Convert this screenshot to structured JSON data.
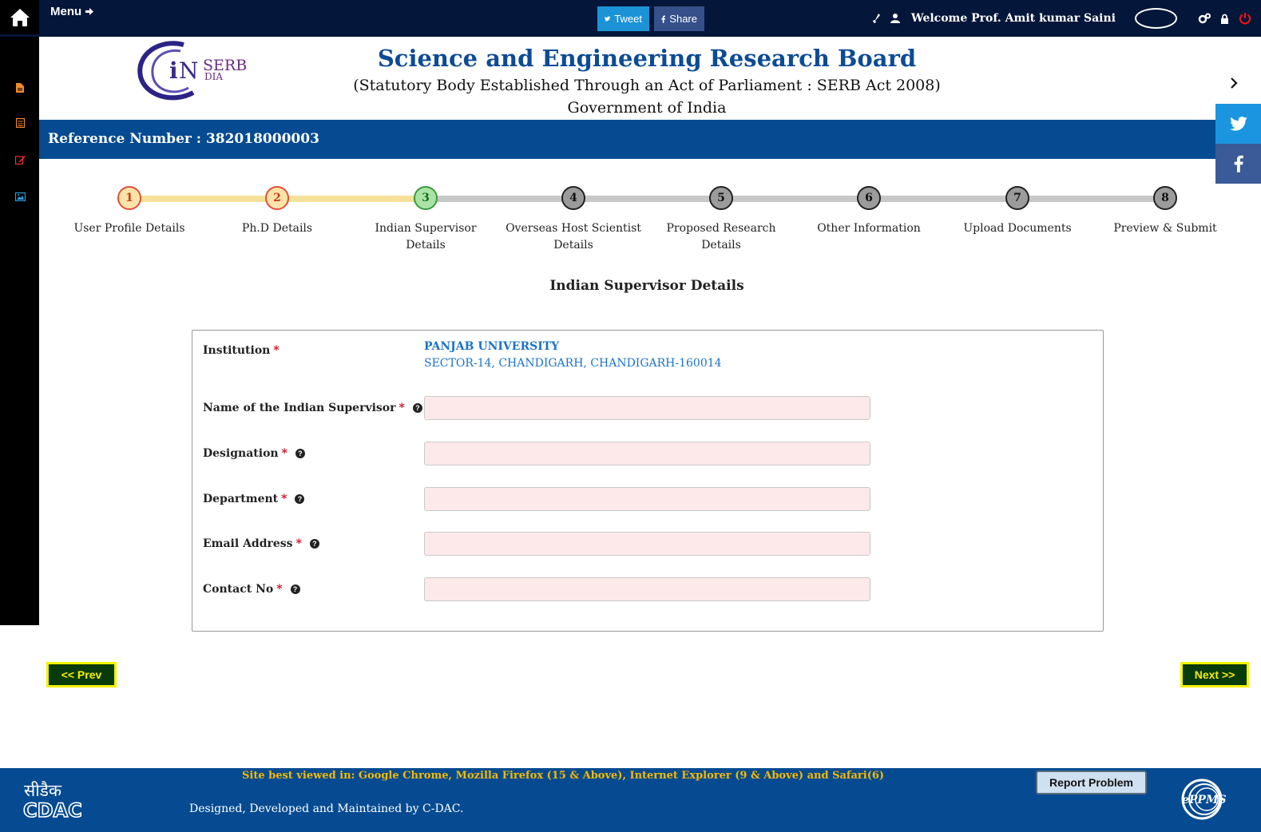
{
  "topbar": {
    "menu_label": "Menu",
    "tweet_label": "Tweet",
    "share_label": "Share",
    "welcome_text": "Welcome Prof. Amit kumar Saini"
  },
  "header": {
    "org_title": "Science and Engineering Research Board",
    "org_subtitle": "(Statutory Body Established Through an Act of Parliament : SERB Act 2008)",
    "org_gov": "Government of India",
    "logo_text_1": "SERB",
    "logo_text_2": "DIA"
  },
  "reference": {
    "text": "Reference Number : 382018000003"
  },
  "stepper": {
    "steps": [
      {
        "num": "1",
        "label": "User Profile Details",
        "state": "completed"
      },
      {
        "num": "2",
        "label": "Ph.D Details",
        "state": "completed"
      },
      {
        "num": "3",
        "label": "Indian Supervisor Details",
        "state": "current"
      },
      {
        "num": "4",
        "label": "Overseas Host Scientist Details",
        "state": "pending"
      },
      {
        "num": "5",
        "label": "Proposed Research Details",
        "state": "pending"
      },
      {
        "num": "6",
        "label": "Other Information",
        "state": "pending"
      },
      {
        "num": "7",
        "label": "Upload Documents",
        "state": "pending"
      },
      {
        "num": "8",
        "label": "Preview & Submit",
        "state": "pending"
      }
    ]
  },
  "form": {
    "section_title": "Indian Supervisor Details",
    "institution_label": "Institution",
    "institution_name": "PANJAB UNIVERSITY",
    "institution_address": "SECTOR-14, CHANDIGARH, CHANDIGARH-160014",
    "required_mark": "*",
    "fields": [
      {
        "label": "Name of the Indian Supervisor",
        "value": ""
      },
      {
        "label": "Designation",
        "value": ""
      },
      {
        "label": "Department",
        "value": ""
      },
      {
        "label": "Email Address",
        "value": ""
      },
      {
        "label": "Contact No",
        "value": ""
      }
    ]
  },
  "nav": {
    "prev_label": "<< Prev",
    "next_label": "Next >>"
  },
  "footer": {
    "best_viewed": "Site best viewed in: Google Chrome, Mozilla Firefox (15 & Above), Internet Explorer (9 & Above) and Safari(6)",
    "designed_by": "Designed, Developed and Maintained by C-DAC.",
    "report_label": "Report Problem",
    "cdac_hindi": "सीडैक",
    "cdac_text": "CDAC",
    "eppms_text": "ePPMS"
  },
  "colors": {
    "topbar": "#04163a",
    "brand_blue": "#064b91",
    "completed_step": "#f8d27f",
    "current_step": "#a6e3a1",
    "pending_step": "#9e9e9e",
    "nav_button": "#073b0a",
    "nav_button_text": "#f5f000"
  }
}
